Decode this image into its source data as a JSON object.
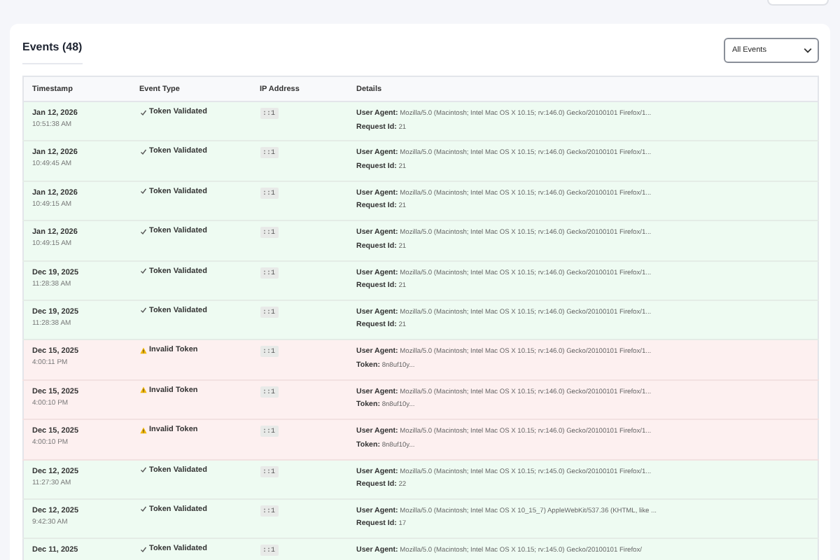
{
  "events": {
    "heading": "Events (48)",
    "filter": {
      "value": "All Events"
    },
    "columns": [
      "Timestamp",
      "Event Type",
      "IP Address",
      "Details"
    ],
    "rows": [
      {
        "date": "Jan 12, 2026",
        "time": "10:51:38 AM",
        "kind": "validated",
        "event": "Token Validated",
        "ip": "::1",
        "details": [
          {
            "label": "User Agent:",
            "value": "Mozilla/5.0 (Macintosh; Intel Mac OS X 10.15; rv:146.0) Gecko/20100101 Firefox/1..."
          },
          {
            "label": "Request Id:",
            "value": "21"
          }
        ]
      },
      {
        "date": "Jan 12, 2026",
        "time": "10:49:45 AM",
        "kind": "validated",
        "event": "Token Validated",
        "ip": "::1",
        "details": [
          {
            "label": "User Agent:",
            "value": "Mozilla/5.0 (Macintosh; Intel Mac OS X 10.15; rv:146.0) Gecko/20100101 Firefox/1..."
          },
          {
            "label": "Request Id:",
            "value": "21"
          }
        ]
      },
      {
        "date": "Jan 12, 2026",
        "time": "10:49:15 AM",
        "kind": "validated",
        "event": "Token Validated",
        "ip": "::1",
        "details": [
          {
            "label": "User Agent:",
            "value": "Mozilla/5.0 (Macintosh; Intel Mac OS X 10.15; rv:146.0) Gecko/20100101 Firefox/1..."
          },
          {
            "label": "Request Id:",
            "value": "21"
          }
        ]
      },
      {
        "date": "Jan 12, 2026",
        "time": "10:49:15 AM",
        "kind": "validated",
        "event": "Token Validated",
        "ip": "::1",
        "details": [
          {
            "label": "User Agent:",
            "value": "Mozilla/5.0 (Macintosh; Intel Mac OS X 10.15; rv:146.0) Gecko/20100101 Firefox/1..."
          },
          {
            "label": "Request Id:",
            "value": "21"
          }
        ]
      },
      {
        "date": "Dec 19, 2025",
        "time": "11:28:38 AM",
        "kind": "validated",
        "event": "Token Validated",
        "ip": "::1",
        "details": [
          {
            "label": "User Agent:",
            "value": "Mozilla/5.0 (Macintosh; Intel Mac OS X 10.15; rv:146.0) Gecko/20100101 Firefox/1..."
          },
          {
            "label": "Request Id:",
            "value": "21"
          }
        ]
      },
      {
        "date": "Dec 19, 2025",
        "time": "11:28:38 AM",
        "kind": "validated",
        "event": "Token Validated",
        "ip": "::1",
        "details": [
          {
            "label": "User Agent:",
            "value": "Mozilla/5.0 (Macintosh; Intel Mac OS X 10.15; rv:146.0) Gecko/20100101 Firefox/1..."
          },
          {
            "label": "Request Id:",
            "value": "21"
          }
        ]
      },
      {
        "date": "Dec 15, 2025",
        "time": "4:00:11 PM",
        "kind": "invalid",
        "event": "Invalid Token",
        "ip": "::1",
        "details": [
          {
            "label": "User Agent:",
            "value": "Mozilla/5.0 (Macintosh; Intel Mac OS X 10.15; rv:146.0) Gecko/20100101 Firefox/1..."
          },
          {
            "label": "Token:",
            "value": "8n8uf10y..."
          }
        ]
      },
      {
        "date": "Dec 15, 2025",
        "time": "4:00:10 PM",
        "kind": "invalid",
        "event": "Invalid Token",
        "ip": "::1",
        "details": [
          {
            "label": "User Agent:",
            "value": "Mozilla/5.0 (Macintosh; Intel Mac OS X 10.15; rv:146.0) Gecko/20100101 Firefox/1..."
          },
          {
            "label": "Token:",
            "value": "8n8uf10y..."
          }
        ]
      },
      {
        "date": "Dec 15, 2025",
        "time": "4:00:10 PM",
        "kind": "invalid",
        "event": "Invalid Token",
        "ip": "::1",
        "details": [
          {
            "label": "User Agent:",
            "value": "Mozilla/5.0 (Macintosh; Intel Mac OS X 10.15; rv:146.0) Gecko/20100101 Firefox/1..."
          },
          {
            "label": "Token:",
            "value": "8n8uf10y..."
          }
        ]
      },
      {
        "date": "Dec 12, 2025",
        "time": "11:27:30 AM",
        "kind": "validated",
        "event": "Token Validated",
        "ip": "::1",
        "details": [
          {
            "label": "User Agent:",
            "value": "Mozilla/5.0 (Macintosh; Intel Mac OS X 10.15; rv:145.0) Gecko/20100101 Firefox/1..."
          },
          {
            "label": "Request Id:",
            "value": "22"
          }
        ]
      },
      {
        "date": "Dec 12, 2025",
        "time": "9:42:30 AM",
        "kind": "validated",
        "event": "Token Validated",
        "ip": "::1",
        "details": [
          {
            "label": "User Agent:",
            "value": "Mozilla/5.0 (Macintosh; Intel Mac OS X 10_15_7) AppleWebKit/537.36 (KHTML, like ..."
          },
          {
            "label": "Request Id:",
            "value": "17"
          }
        ]
      },
      {
        "date": "Dec 11, 2025",
        "kind": "validated",
        "event": "Token Validated",
        "ip": "::1",
        "details": [
          {
            "label": "User Agent:",
            "value": "Mozilla/5.0 (Macintosh; Intel Mac OS X 10.15; rv:145.0) Gecko/20100101 Firefox/"
          }
        ]
      }
    ]
  }
}
